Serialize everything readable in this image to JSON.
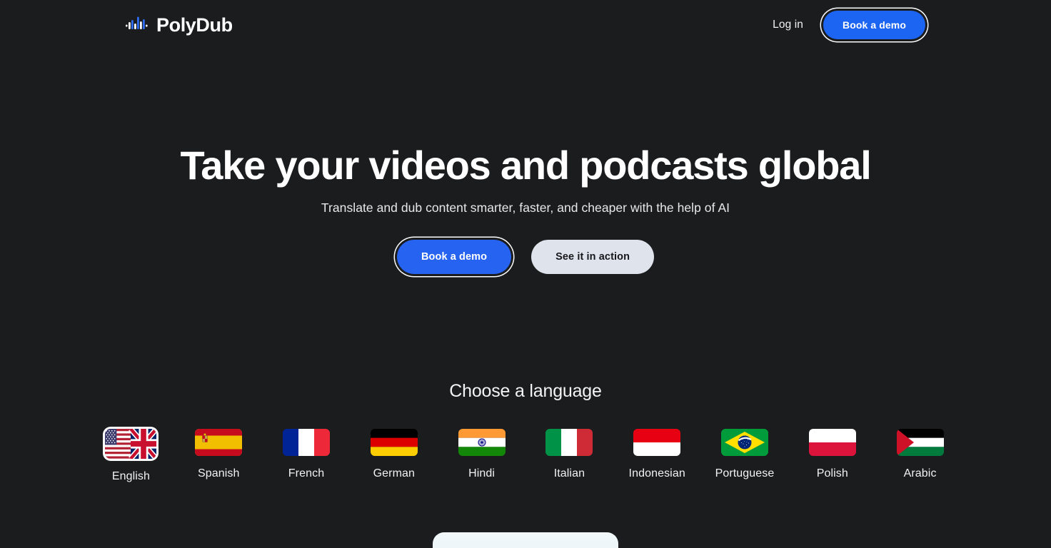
{
  "brand": {
    "name": "PolyDub",
    "logo_icon": "audio-waveform-icon",
    "accent_color": "#1c64f2"
  },
  "header": {
    "login_label": "Log in",
    "demo_label": "Book a demo"
  },
  "hero": {
    "title": "Take your videos and podcasts global",
    "subtitle": "Translate and dub content smarter, faster, and cheaper with the help of AI",
    "primary_cta": "Book a demo",
    "secondary_cta": "See it in action"
  },
  "languages": {
    "heading": "Choose a language",
    "selected": "English",
    "items": [
      {
        "label": "English",
        "flag": "flag-us-uk",
        "selected": true
      },
      {
        "label": "Spanish",
        "flag": "flag-es",
        "selected": false
      },
      {
        "label": "French",
        "flag": "flag-fr",
        "selected": false
      },
      {
        "label": "German",
        "flag": "flag-de",
        "selected": false
      },
      {
        "label": "Hindi",
        "flag": "flag-in",
        "selected": false
      },
      {
        "label": "Italian",
        "flag": "flag-it",
        "selected": false
      },
      {
        "label": "Indonesian",
        "flag": "flag-id",
        "selected": false
      },
      {
        "label": "Portuguese",
        "flag": "flag-br",
        "selected": false
      },
      {
        "label": "Polish",
        "flag": "flag-pl",
        "selected": false
      },
      {
        "label": "Arabic",
        "flag": "flag-ps",
        "selected": false
      }
    ]
  },
  "colors": {
    "background": "#1b1c1e",
    "primary_button": "#2563f0",
    "secondary_button": "#dfe3ec",
    "text": "#ffffff"
  }
}
